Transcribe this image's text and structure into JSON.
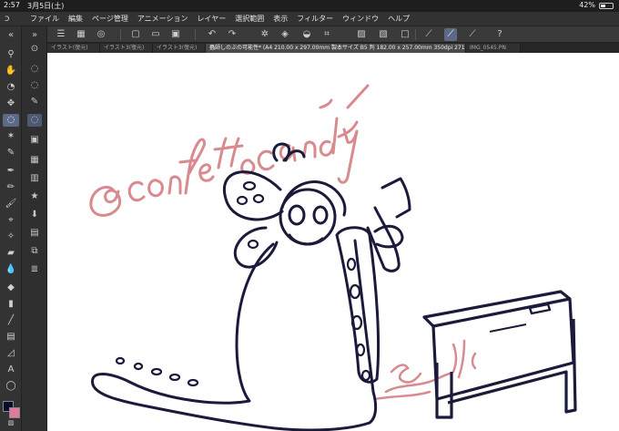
{
  "status": {
    "time": "2:57",
    "date": "3月5日(土)",
    "battery": "42%",
    "battery_level": 0.42
  },
  "menu": [
    "ファイル",
    "編集",
    "ページ管理",
    "アニメーション",
    "レイヤー",
    "選択範囲",
    "表示",
    "フィルター",
    "ウィンドウ",
    "ヘルプ"
  ],
  "tabs": [
    {
      "label": "イラスト(復元)",
      "active": false
    },
    {
      "label": "イラスト3(復元)",
      "active": false
    },
    {
      "label": "イラスト3(復元)",
      "active": false
    },
    {
      "label": "蟲師しのぶの可能性* (A4 210.00 x 297.00mm 製本サイズ B5 判 182.00 x 257.00mm 350dpi 271.6%)",
      "active": true
    },
    {
      "label": "IMG_0545.PN",
      "active": false
    }
  ],
  "canvas": {
    "signature_text": "@confettocandy",
    "ink_color": "#1a1a3a",
    "signature_color": "#d98a8f"
  },
  "colors": {
    "main": "#0a0a2a",
    "sub": "#e27aa0",
    "accent": "#5c6a88"
  }
}
